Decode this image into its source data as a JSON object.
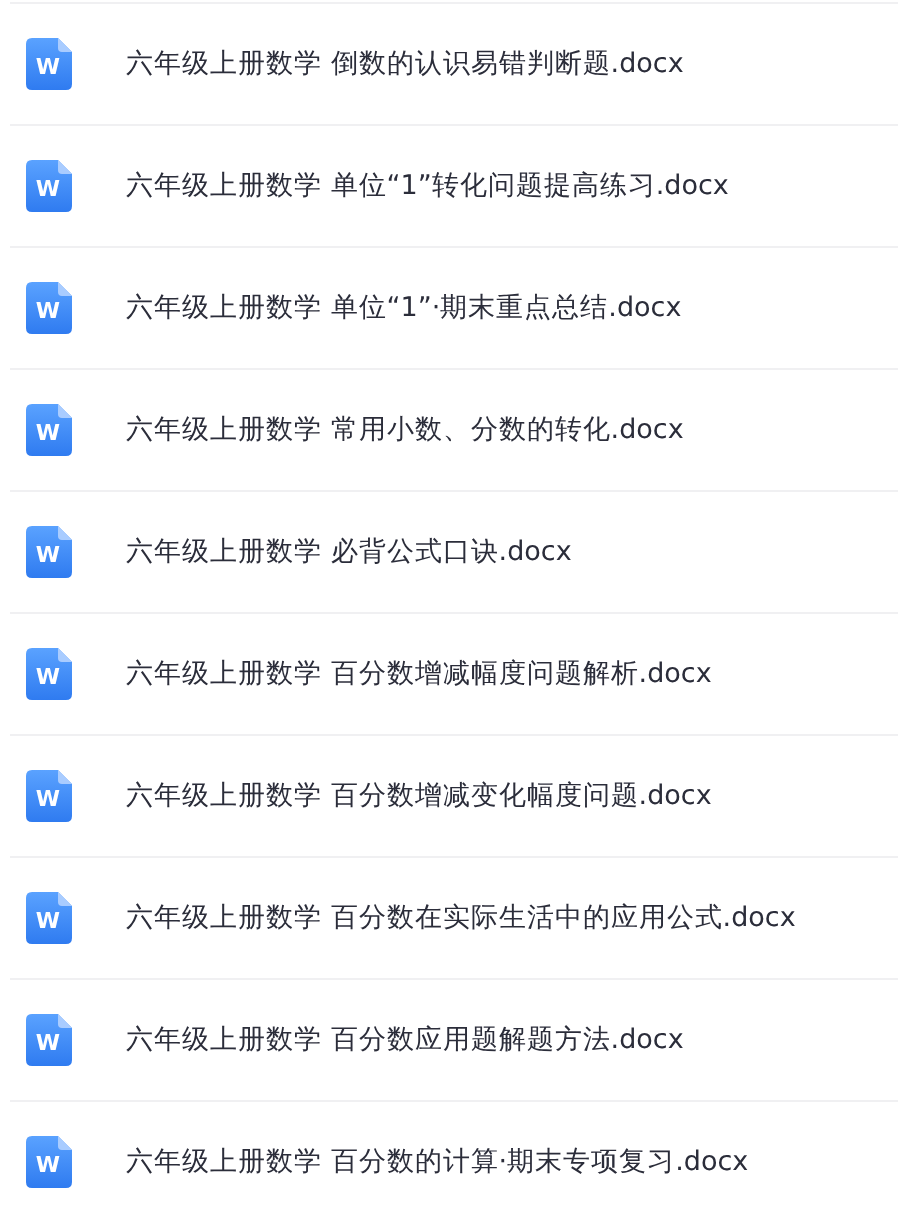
{
  "files": [
    {
      "icon_letter": "W",
      "name": "六年级上册数学 倒数的认识易错判断题.docx"
    },
    {
      "icon_letter": "W",
      "name": "六年级上册数学 单位“1”转化问题提高练习.docx"
    },
    {
      "icon_letter": "W",
      "name": "六年级上册数学 单位“1”·期末重点总结.docx"
    },
    {
      "icon_letter": "W",
      "name": "六年级上册数学 常用小数、分数的转化.docx"
    },
    {
      "icon_letter": "W",
      "name": "六年级上册数学 必背公式口诀.docx"
    },
    {
      "icon_letter": "W",
      "name": "六年级上册数学 百分数增减幅度问题解析.docx"
    },
    {
      "icon_letter": "W",
      "name": "六年级上册数学 百分数增减变化幅度问题.docx"
    },
    {
      "icon_letter": "W",
      "name": "六年级上册数学 百分数在实际生活中的应用公式.docx"
    },
    {
      "icon_letter": "W",
      "name": "六年级上册数学 百分数应用题解题方法.docx"
    },
    {
      "icon_letter": "W",
      "name": "六年级上册数学 百分数的计算·期末专项复习.docx"
    }
  ]
}
